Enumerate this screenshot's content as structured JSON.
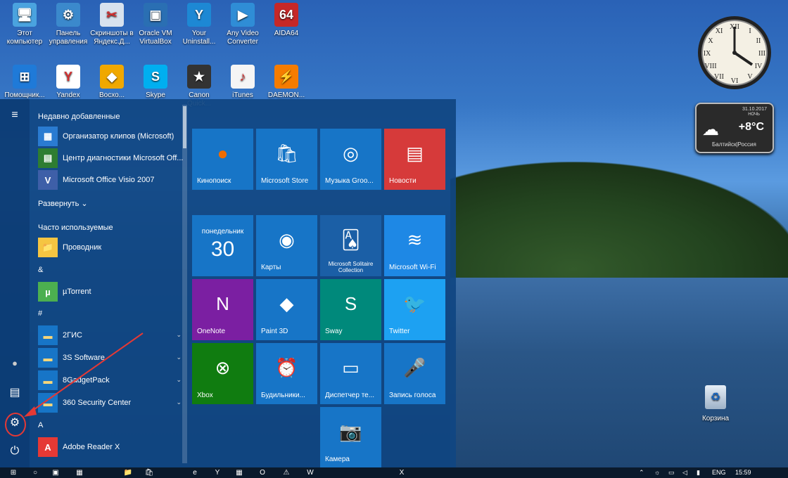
{
  "desktop": {
    "icons": [
      {
        "label": "Этот компьютер",
        "glyph": "🖥",
        "color": "#4aa3df"
      },
      {
        "label": "Панель управления",
        "glyph": "⚙",
        "color": "#3b89cc"
      },
      {
        "label": "Скриншоты в Яндекс.Д...",
        "glyph": "✂",
        "color": "#d7e2ee"
      },
      {
        "label": "Oracle VM VirtualBox",
        "glyph": "▣",
        "color": "#2a6fb3"
      },
      {
        "label": "Your Uninstall...",
        "glyph": "Y",
        "color": "#1d88d4"
      },
      {
        "label": "Any Video Converter",
        "glyph": "▶",
        "color": "#2f8dd6"
      },
      {
        "label": "AIDA64",
        "glyph": "64",
        "color": "#c62828"
      }
    ],
    "icons_row2": [
      {
        "label": "Помощник...",
        "glyph": "⊞",
        "color": "#1f7ad8"
      },
      {
        "label": "Yandex",
        "glyph": "Y",
        "color": "#ffffff"
      },
      {
        "label": "Восхо...",
        "glyph": "◆",
        "color": "#f0a800"
      },
      {
        "label": "Skype",
        "glyph": "S",
        "color": "#00aff0"
      },
      {
        "label": "Canon Quick...",
        "glyph": "★",
        "color": "#333333"
      },
      {
        "label": "iTunes",
        "glyph": "♪",
        "color": "#f5f5f5"
      },
      {
        "label": "DAEMON...",
        "glyph": "⚡",
        "color": "#f57c00"
      }
    ],
    "recycle_bin": "Корзина"
  },
  "gadgets": {
    "weather": {
      "date": "31.10.2017",
      "period": "НОЧЬ",
      "temp": "+8°C",
      "city": "Балтийск|Россия"
    }
  },
  "start_menu": {
    "recent_header": "Недавно добавленные",
    "recent": [
      {
        "label": "Организатор клипов (Microsoft)",
        "glyph": "▦",
        "color": "#2a7bd1"
      },
      {
        "label": "Центр диагностики Microsoft Off...",
        "glyph": "▤",
        "color": "#2e7d32"
      },
      {
        "label": "Microsoft Office Visio 2007",
        "glyph": "V",
        "color": "#3e5fa8"
      }
    ],
    "expand_label": "Развернуть",
    "frequent_header": "Часто используемые",
    "frequent": [
      {
        "label": "Проводник",
        "glyph": "📁",
        "color": "#f5c542"
      }
    ],
    "groups": [
      {
        "letter": "&",
        "apps": [
          {
            "label": "µTorrent",
            "glyph": "µ",
            "color": "#4caf50"
          }
        ]
      },
      {
        "letter": "#",
        "apps": [
          {
            "label": "2ГИС",
            "glyph": "▬",
            "color": "#f5d67a",
            "folder": true
          },
          {
            "label": "3S Software",
            "glyph": "▬",
            "color": "#f5d67a",
            "folder": true
          },
          {
            "label": "8GadgetPack",
            "glyph": "▬",
            "color": "#f5d67a",
            "folder": true
          },
          {
            "label": "360 Security Center",
            "glyph": "▬",
            "color": "#f5d67a",
            "folder": true
          }
        ]
      },
      {
        "letter": "A",
        "apps": [
          {
            "label": "Adobe Reader X",
            "glyph": "A",
            "color": "#e53935"
          }
        ]
      }
    ],
    "rail": {
      "menu": "≡",
      "user": "●",
      "docs": "▤",
      "settings": "⚙",
      "power": "⏻"
    }
  },
  "tiles": [
    {
      "label": "Кинопоиск",
      "glyph": "●",
      "bg": "#1775c7",
      "glyphColor": "#ef6c00"
    },
    {
      "label": "Microsoft Store",
      "glyph": "🛍",
      "bg": "#1775c7"
    },
    {
      "label": "Музыка Groo...",
      "glyph": "◎",
      "bg": "#1775c7"
    },
    {
      "label": "Новости",
      "glyph": "▤",
      "bg": "#d63a3a"
    },
    {
      "label": "",
      "day": "понедельник",
      "date": "30",
      "bg": "#1775c7"
    },
    {
      "label": "Карты",
      "glyph": "◉",
      "bg": "#1775c7"
    },
    {
      "label": "Microsoft Solitaire Collection",
      "glyph": "🂡",
      "bg": "#1b5fa6"
    },
    {
      "label": "Microsoft Wi-Fi",
      "glyph": "≋",
      "bg": "#1e88e5"
    },
    {
      "label": "OneNote",
      "glyph": "N",
      "bg": "#7b1fa2"
    },
    {
      "label": "Paint 3D",
      "glyph": "◆",
      "bg": "#1775c7"
    },
    {
      "label": "Sway",
      "glyph": "S",
      "bg": "#00897b"
    },
    {
      "label": "Twitter",
      "glyph": "🐦",
      "bg": "#1da1f2"
    },
    {
      "label": "Xbox",
      "glyph": "⊗",
      "bg": "#107c10"
    },
    {
      "label": "Будильники...",
      "glyph": "⏰",
      "bg": "#1775c7"
    },
    {
      "label": "Диспетчер те...",
      "glyph": "▭",
      "bg": "#1775c7"
    },
    {
      "label": "Запись голоса",
      "glyph": "🎤",
      "bg": "#1775c7"
    },
    {
      "label": "Камера",
      "glyph": "📷",
      "bg": "#1775c7"
    }
  ],
  "taskbar": {
    "items": [
      "⊞",
      "○",
      "▣",
      "▦",
      "📁",
      "🛍",
      "e",
      "Y",
      "▦",
      "O",
      "⚠",
      "W",
      "X"
    ],
    "tray": {
      "lang": "ENG",
      "time": "15:59"
    }
  }
}
